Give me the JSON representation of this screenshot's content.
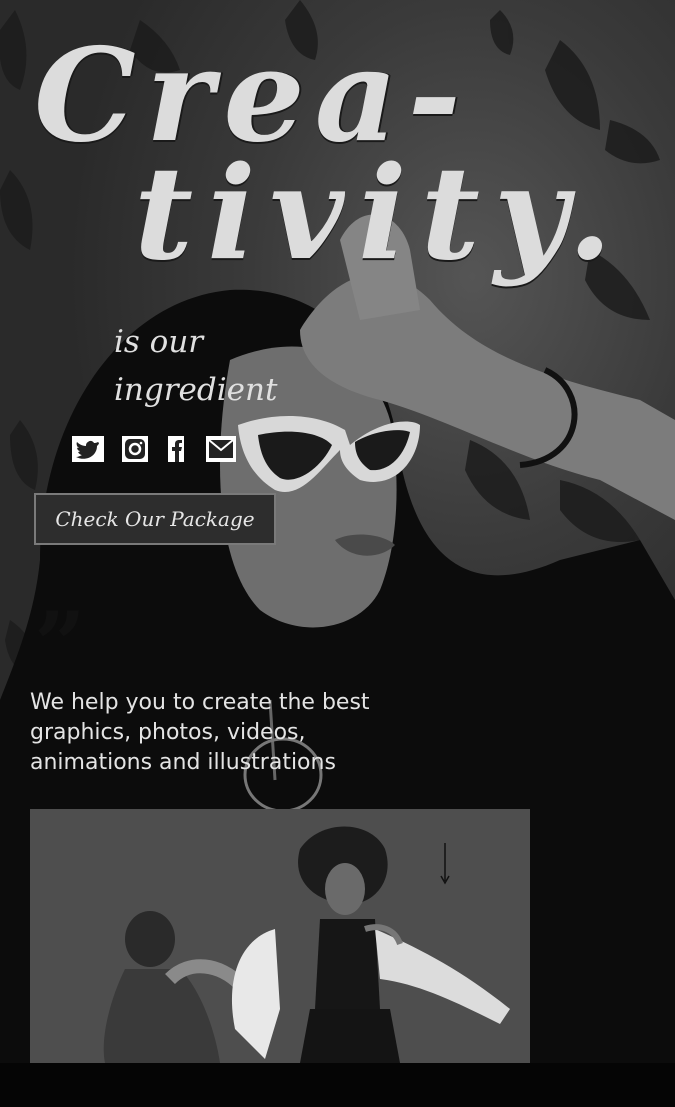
{
  "hero": {
    "title_line1": "Crea-",
    "title_line2": "tivity.",
    "subtitle_line1": "is our",
    "subtitle_line2": "ingredient"
  },
  "social": {
    "icons": [
      "twitter-icon",
      "instagram-icon",
      "facebook-icon",
      "mail-icon"
    ]
  },
  "cta": {
    "label": "Check Our Package"
  },
  "quote": {
    "mark": "”",
    "text": "We help you to create the best graphics, photos, videos, animations and illustrations"
  },
  "colors": {
    "background": "#2e2e2e",
    "text": "#e2e2e2",
    "button_bg": "#2d2d2d",
    "button_border": "#7a7a7a"
  }
}
